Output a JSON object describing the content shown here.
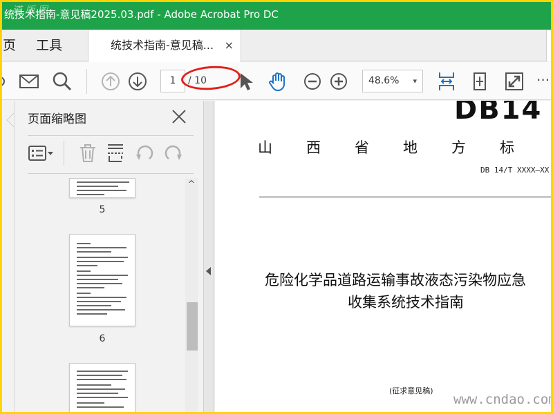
{
  "window": {
    "title": "统技术指南-意见稿2025.03.pdf - Adobe Acrobat Pro DC",
    "watermark_top": "道 版 图"
  },
  "tabs": {
    "home": "页",
    "tools": "工具",
    "document": "统技术指南-意见稿...",
    "close": "×"
  },
  "toolbar": {
    "icons": [
      "email-icon",
      "search-icon",
      "prev-page-icon",
      "next-page-icon",
      "select-cursor-icon",
      "hand-icon",
      "zoom-out-icon",
      "zoom-in-icon",
      "fit-width-icon",
      "scroll-mode-icon",
      "fullscreen-icon",
      "more-icon"
    ],
    "page_current": "1",
    "page_total": "/ 10",
    "zoom": "48.6%",
    "zoom_caret": "▾",
    "more": "···"
  },
  "panel": {
    "title": "页面缩略图",
    "thumbnails": [
      {
        "label": "5"
      },
      {
        "label": "6"
      }
    ],
    "scroll_up": "^"
  },
  "document": {
    "code": "DB14",
    "heading_chars": [
      "山",
      "西",
      "省",
      "地",
      "方",
      "标"
    ],
    "std_number": "DB 14/T XXXX—XX",
    "title_line1": "危险化学品道路运输事故液态污染物应急",
    "title_line2": "收集系统技术指南",
    "note": "(征求意见稿)"
  },
  "watermark_bottom": "www.cndao.com",
  "colors": {
    "titlebar": "#1fa34a",
    "accent_blue": "#1a73c9",
    "annotation_red": "#e0201a",
    "frame": "#ffd400"
  }
}
